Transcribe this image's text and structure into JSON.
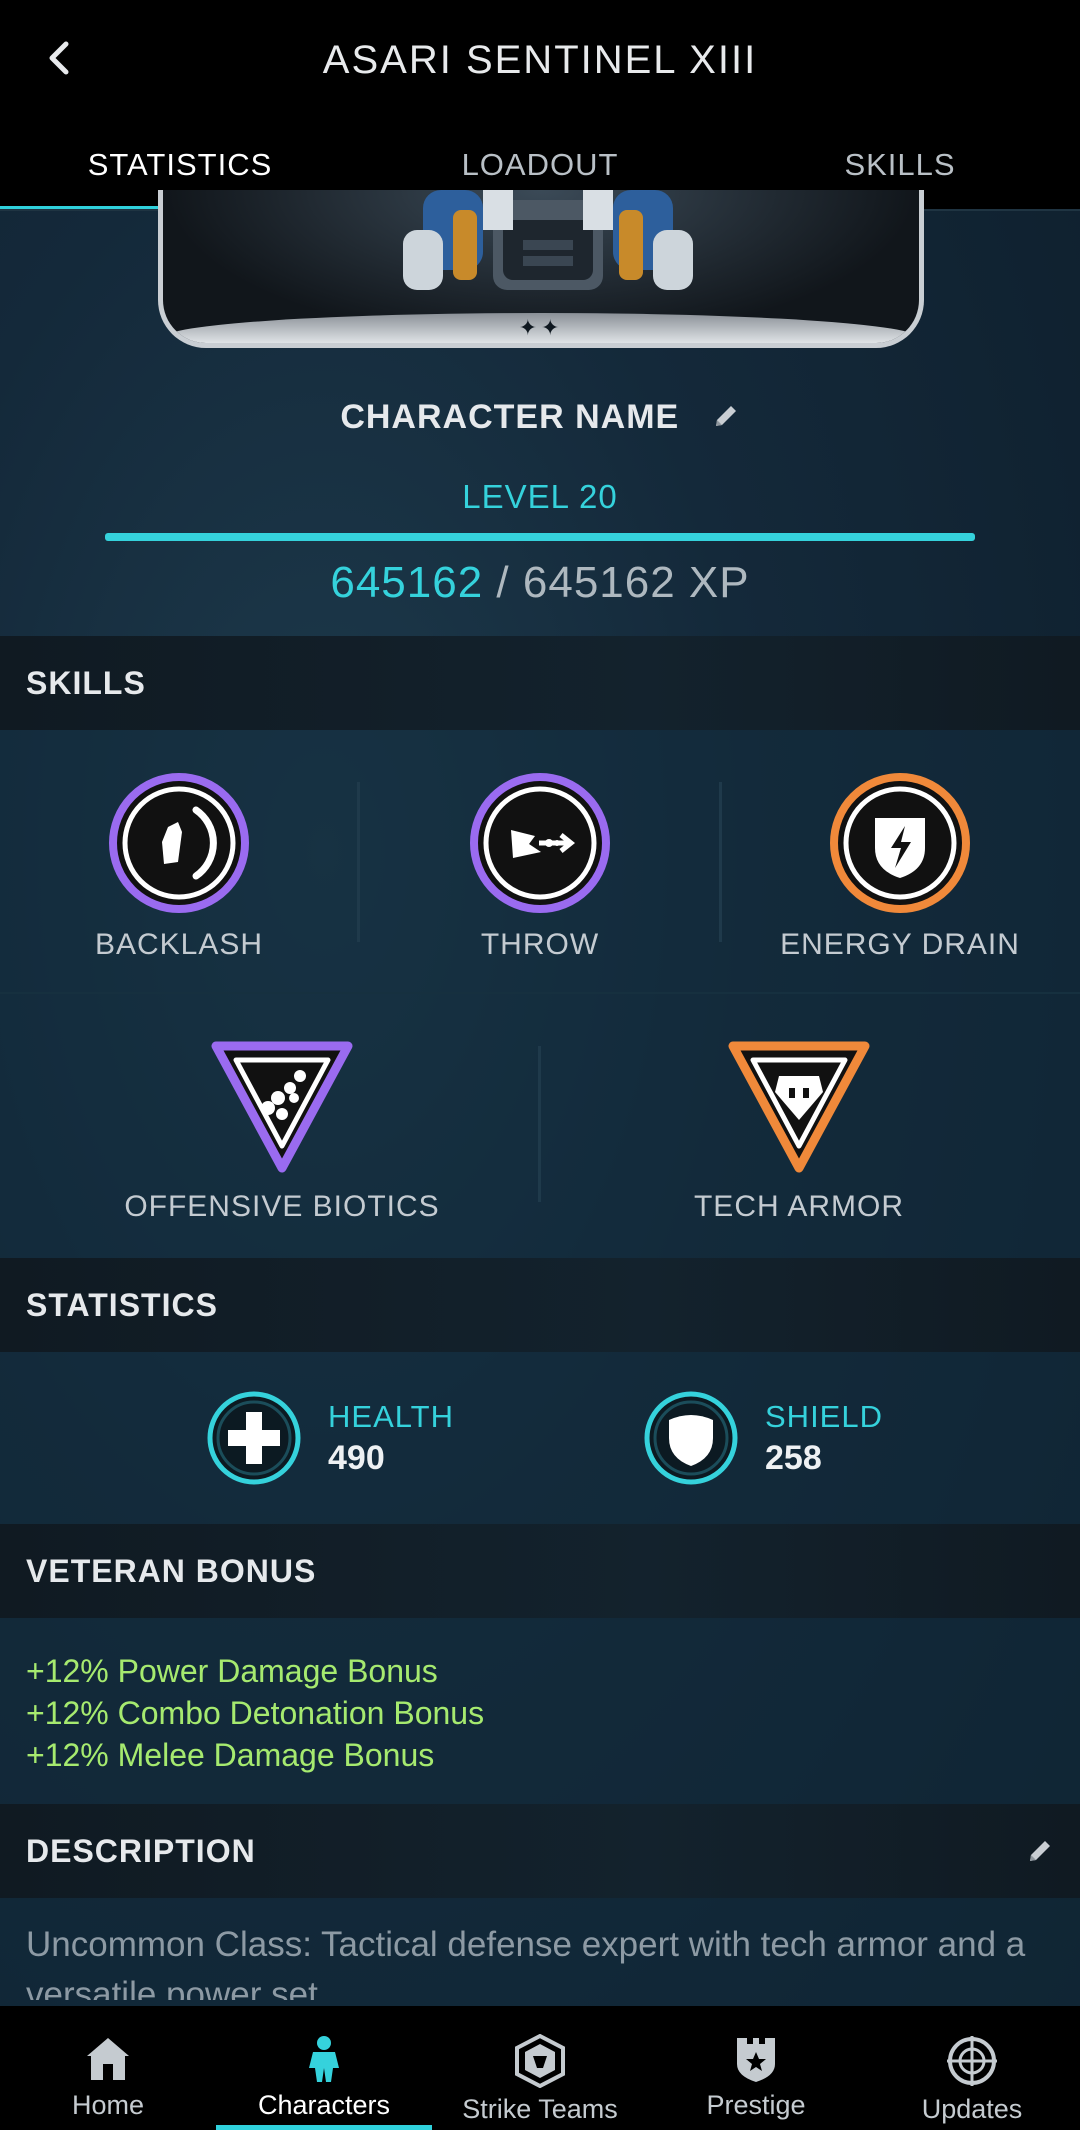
{
  "header": {
    "title": "ASARI SENTINEL XIII"
  },
  "tabs": [
    {
      "label": "STATISTICS",
      "active": true
    },
    {
      "label": "LOADOUT",
      "active": false
    },
    {
      "label": "SKILLS",
      "active": false
    }
  ],
  "character": {
    "name": "CHARACTER NAME",
    "level": "LEVEL 20",
    "xp_current": "645162",
    "xp_sep": " / ",
    "xp_max": "645162 XP",
    "xp_progress": 1.0,
    "rank_stars": "✦✦"
  },
  "skills_section": {
    "title": "SKILLS",
    "row1": [
      {
        "label": "BACKLASH",
        "ring_color": "#9a6bf0",
        "icon": "backlash-icon"
      },
      {
        "label": "THROW",
        "ring_color": "#9a6bf0",
        "icon": "throw-icon"
      },
      {
        "label": "ENERGY DRAIN",
        "ring_color": "#f0893a",
        "icon": "energy-drain-icon"
      }
    ],
    "row2": [
      {
        "label": "OFFENSIVE BIOTICS",
        "ring_color": "#9a6bf0",
        "icon": "offensive-biotics-icon"
      },
      {
        "label": "TECH ARMOR",
        "ring_color": "#f0893a",
        "icon": "tech-armor-icon"
      }
    ]
  },
  "statistics": {
    "title": "STATISTICS",
    "health": {
      "label": "HEALTH",
      "value": "490",
      "icon": "health-icon"
    },
    "shield": {
      "label": "SHIELD",
      "value": "258",
      "icon": "shield-icon"
    }
  },
  "veteran_bonus": {
    "title": "VETERAN BONUS",
    "items": [
      "+12% Power Damage Bonus",
      "+12% Combo Detonation Bonus",
      "+12% Melee Damage Bonus"
    ]
  },
  "description": {
    "title": "DESCRIPTION",
    "text": "Uncommon Class: Tactical defense expert with tech armor and a versatile power set."
  },
  "bottom_nav": [
    {
      "label": "Home",
      "icon": "home-icon",
      "active": false
    },
    {
      "label": "Characters",
      "icon": "characters-icon",
      "active": true
    },
    {
      "label": "Strike Teams",
      "icon": "strike-teams-icon",
      "active": false
    },
    {
      "label": "Prestige",
      "icon": "prestige-icon",
      "active": false
    },
    {
      "label": "Updates",
      "icon": "updates-icon",
      "active": false
    }
  ],
  "colors": {
    "accent": "#35d2dc",
    "biotic": "#9a6bf0",
    "tech": "#f0893a",
    "bonus": "#a6ea6f"
  }
}
